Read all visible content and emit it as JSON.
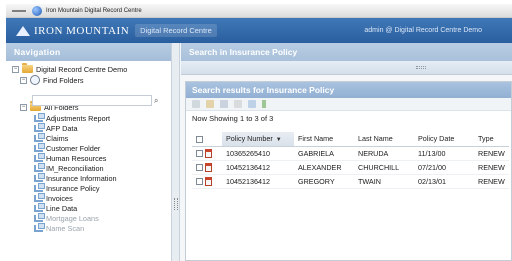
{
  "window": {
    "title": "Iron Mountain Digital Record Centre"
  },
  "header": {
    "logo_text": "IRON MOUNTAIN",
    "app_name": "Digital Record Centre",
    "user_info": "admin @ Digital Record Centre Demo"
  },
  "nav": {
    "title": "Navigation",
    "root": "Digital Record Centre Demo",
    "find_folders": "Find Folders",
    "all_folders": "All Folders",
    "folders": [
      "Adjustments Report",
      "AFP Data",
      "Claims",
      "Customer Folder",
      "Human Resources",
      "IM_Reconciliation",
      "Insurance Information",
      "Insurance Policy",
      "Invoices",
      "Line Data",
      "Mortgage Loans",
      "Name Scan"
    ]
  },
  "search": {
    "title": "Search in Insurance Policy"
  },
  "results": {
    "title": "Search results for Insurance Policy",
    "showing": "Now Showing 1 to 3 of 3",
    "columns": [
      "Policy Number",
      "First Name",
      "Last Name",
      "Policy Date",
      "Type"
    ],
    "sorted_column": "Policy Number",
    "rows": [
      {
        "policy": "10365265410",
        "first": "GABRIELA",
        "last": "NERUDA",
        "date": "11/13/00",
        "type": "RENEW"
      },
      {
        "policy": "10452136412",
        "first": "ALEXANDER",
        "last": "CHURCHILL",
        "date": "07/21/00",
        "type": "RENEW"
      },
      {
        "policy": "10452136412",
        "first": "GREGORY",
        "last": "TWAIN",
        "date": "02/13/01",
        "type": "RENEW"
      }
    ]
  }
}
